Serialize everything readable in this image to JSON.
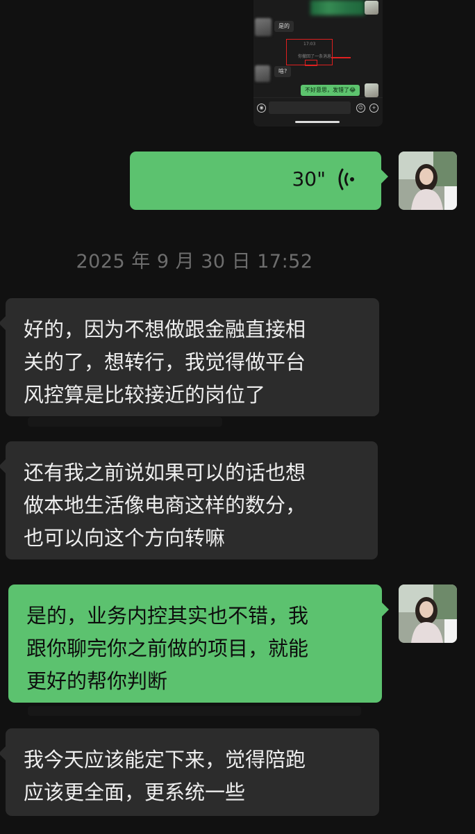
{
  "embedded_screenshot": {
    "msg_left_1": "是的",
    "time": "17:03",
    "recall_notice": "你撤回了一条消息",
    "msg_left_2": "啥?",
    "msg_right": "不好意思，发错了😂"
  },
  "voice_message": {
    "duration": "30\""
  },
  "timestamp": "2025 年 9 月 30 日 17:52",
  "messages": [
    {
      "side": "theirs",
      "lines": [
        "好的，因为不想做跟金融直接相",
        "关的了，想转行，我觉得做平台",
        "风控算是比较接近的岗位了"
      ]
    },
    {
      "side": "theirs",
      "lines": [
        "还有我之前说如果可以的话也想",
        "做本地生活像电商这样的数分，",
        "也可以向这个方向转嘛"
      ]
    },
    {
      "side": "mine",
      "lines": [
        "是的，业务内控其实也不错，我",
        "跟你聊完你之前做的项目，就能",
        "更好的帮你判断"
      ]
    },
    {
      "side": "theirs",
      "lines": [
        "我今天应该能定下来，觉得陪跑",
        "应该更全面，更系统一些"
      ]
    }
  ],
  "colors": {
    "background": "#111111",
    "my_bubble": "#5cc26f",
    "their_bubble": "#2c2c2c",
    "timestamp_text": "#6e6e6e"
  }
}
